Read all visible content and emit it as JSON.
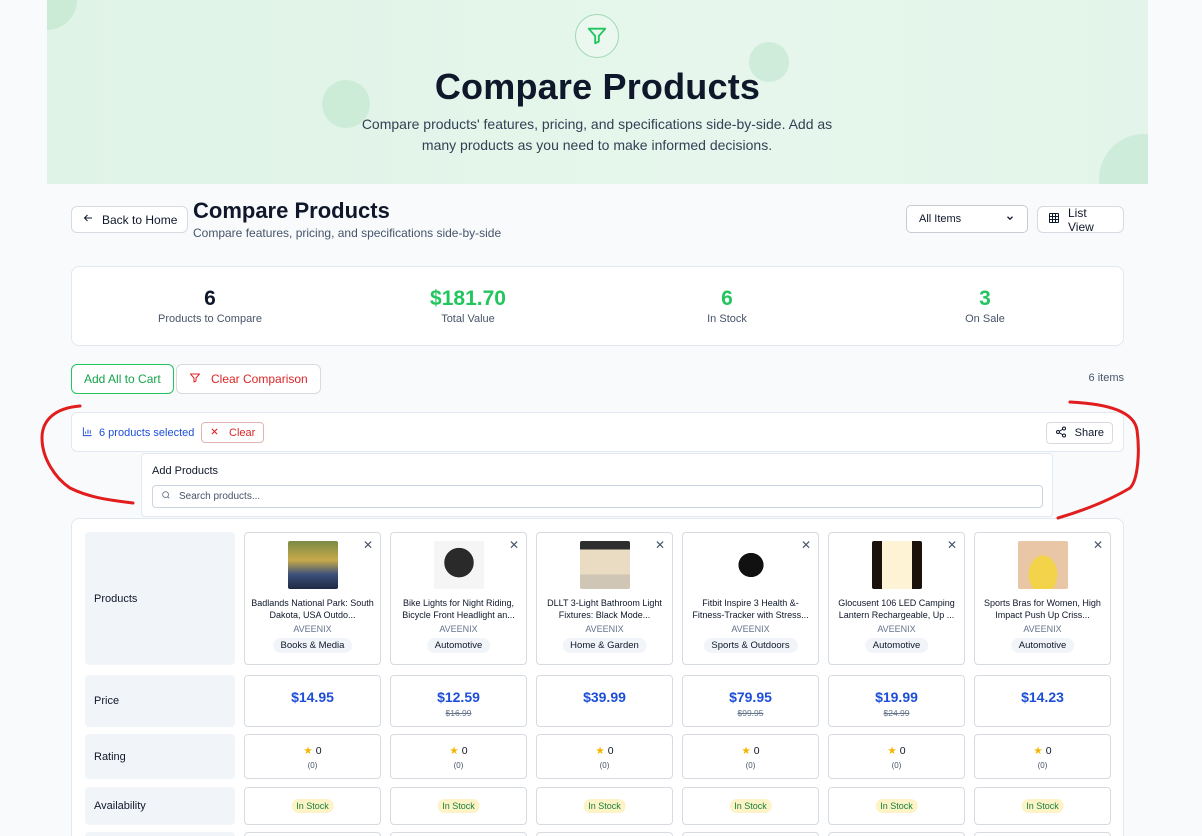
{
  "hero": {
    "title": "Compare Products",
    "subtitle": "Compare products' features, pricing, and specifications side-by-side. Add as many products as you need to make informed decisions."
  },
  "header": {
    "back_label": "Back to Home",
    "title": "Compare Products",
    "subtitle": "Compare features, pricing, and specifications side-by-side",
    "filter_selected": "All Items",
    "view_label": "List View"
  },
  "stats": [
    {
      "value": "6",
      "label": "Products to Compare",
      "color": "#0f172a"
    },
    {
      "value": "$181.70",
      "label": "Total Value",
      "color": "#22c55e"
    },
    {
      "value": "6",
      "label": "In Stock",
      "color": "#22c55e"
    },
    {
      "value": "3",
      "label": "On Sale",
      "color": "#22c55e"
    }
  ],
  "actions": {
    "add_all": "Add All to Cart",
    "clear_comparison": "Clear Comparison",
    "items_count": "6 items"
  },
  "selection": {
    "selected_text": "6 products selected",
    "clear_label": "Clear",
    "share_label": "Share"
  },
  "add_products": {
    "title": "Add Products",
    "placeholder": "Search products..."
  },
  "rows": {
    "products": "Products",
    "price": "Price",
    "rating": "Rating",
    "availability": "Availability"
  },
  "products": [
    {
      "name": "Badlands National Park: South Dakota, USA Outdo...",
      "brand": "AVEENIX",
      "category": "Books & Media",
      "price": "$14.95",
      "original": "",
      "rating": "0",
      "reviews": "(0)",
      "stock": "In Stock",
      "image_icon": "book-photo"
    },
    {
      "name": "Bike Lights for Night Riding, Bicycle Front Headlight an...",
      "brand": "AVEENIX",
      "category": "Automotive",
      "price": "$12.59",
      "original": "$16.99",
      "rating": "0",
      "reviews": "(0)",
      "stock": "In Stock",
      "image_icon": "bike-light-photo"
    },
    {
      "name": "DLLT 3-Light Bathroom Light Fixtures: Black Mode...",
      "brand": "AVEENIX",
      "category": "Home & Garden",
      "price": "$39.99",
      "original": "",
      "rating": "0",
      "reviews": "(0)",
      "stock": "In Stock",
      "image_icon": "light-fixture-photo"
    },
    {
      "name": "Fitbit Inspire 3 Health &-Fitness-Tracker with Stress...",
      "brand": "AVEENIX",
      "category": "Sports & Outdoors",
      "price": "$79.95",
      "original": "$99.95",
      "rating": "0",
      "reviews": "(0)",
      "stock": "In Stock",
      "image_icon": "fitness-tracker-photo"
    },
    {
      "name": "Glocusent 106 LED Camping Lantern Rechargeable, Up ...",
      "brand": "AVEENIX",
      "category": "Automotive",
      "price": "$19.99",
      "original": "$24.99",
      "rating": "0",
      "reviews": "(0)",
      "stock": "In Stock",
      "image_icon": "lantern-photo"
    },
    {
      "name": "Sports Bras for Women, High Impact Push Up Criss...",
      "brand": "AVEENIX",
      "category": "Automotive",
      "price": "$14.23",
      "original": "",
      "rating": "0",
      "reviews": "(0)",
      "stock": "In Stock",
      "image_icon": "sports-bra-photo"
    }
  ],
  "colors": {
    "accent_green": "#22c55e",
    "price_blue": "#1d4ed8",
    "danger_red": "#dc2626",
    "annotation_red": "#e11d1d"
  }
}
